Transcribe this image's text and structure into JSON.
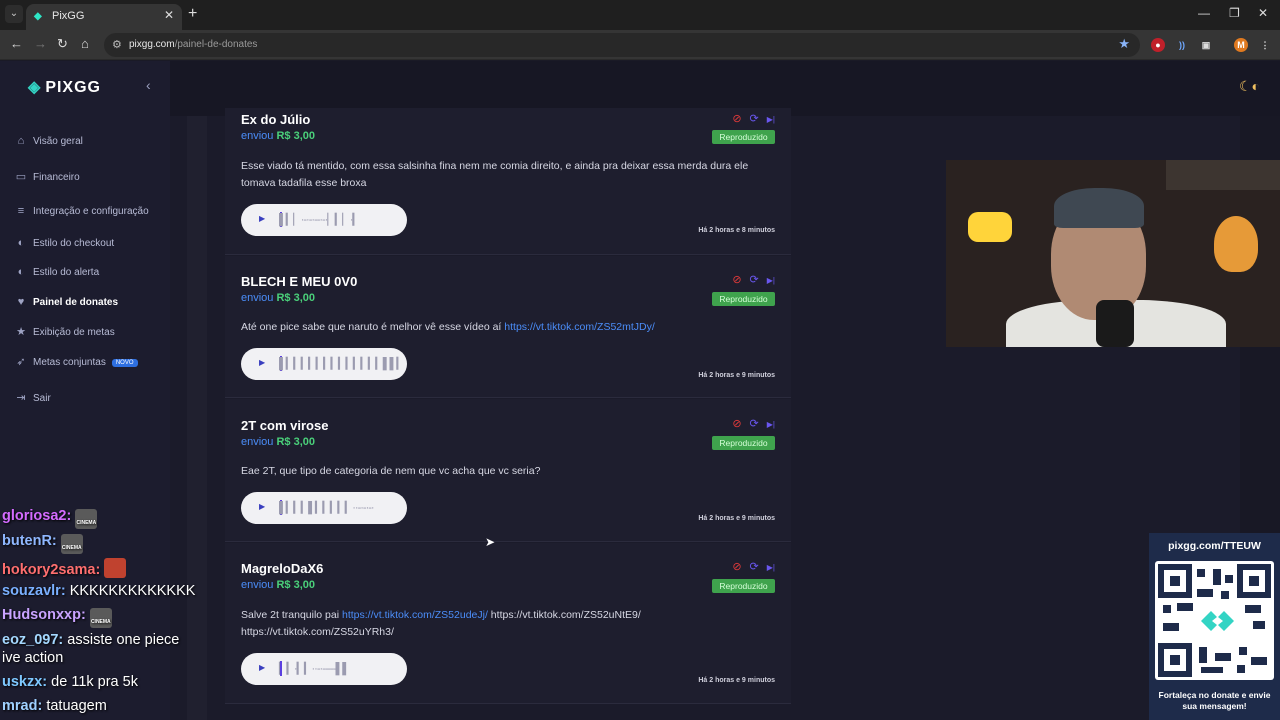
{
  "browser": {
    "tab_title": "PixGG",
    "url_host": "pixgg.com",
    "url_path": "/painel-de-donates",
    "profile_initial": "M"
  },
  "sidebar": {
    "logo": "PIXGG",
    "items": [
      {
        "label": "Visão geral",
        "icon": "home-icon"
      },
      {
        "label": "Financeiro",
        "icon": "wallet-icon"
      },
      {
        "label": "Integração e configuração",
        "icon": "settings-icon"
      },
      {
        "label": "Estilo do checkout",
        "icon": "palette-icon"
      },
      {
        "label": "Estilo do alerta",
        "icon": "palette-icon"
      },
      {
        "label": "Painel de donates",
        "icon": "donates-icon"
      },
      {
        "label": "Exibição de metas",
        "icon": "star-icon"
      },
      {
        "label": "Metas conjuntas",
        "icon": "rocket-icon",
        "badge": "NOVO"
      },
      {
        "label": "Sair",
        "icon": "logout-icon"
      }
    ]
  },
  "donations": [
    {
      "name": "Ex do Júlio",
      "sent": "enviou",
      "amount": "R$ 3,00",
      "message": "Esse viado tá mentido, com essa salsinha fina nem me comia direito, e ainda pra deixar essa merda dura ele tomava tadafila esse broxa",
      "status": "Reproduzido",
      "time": "Há 2 horas e 8 minutos"
    },
    {
      "name": "BLECH E MEU 0V0",
      "sent": "enviou",
      "amount": "R$ 3,00",
      "message_text": "Até one pice sabe que naruto é melhor vê esse vídeo aí ",
      "message_link": "https://vt.tiktok.com/ZS52mtJDy/",
      "status": "Reproduzido",
      "time": "Há 2 horas e 9 minutos"
    },
    {
      "name": "2T com virose",
      "sent": "enviou",
      "amount": "R$ 3,00",
      "message": "Eae 2T, que tipo de categoria de nem que vc acha que vc seria?",
      "status": "Reproduzido",
      "time": "Há 2 horas e 9 minutos"
    },
    {
      "name": "MagreloDaX6",
      "sent": "enviou",
      "amount": "R$ 3,00",
      "message_text": "Salve 2t tranquilo pai ",
      "message_link": "https://vt.tiktok.com/ZS52udeJj/",
      "message_rest": " https://vt.tiktok.com/ZS52uNtE9/ https://vt.tiktok.com/ZS52uYRh3/",
      "status": "Reproduzido",
      "time": "Há 2 horas e 9 minutos"
    }
  ],
  "chat": [
    {
      "user": "gloriosa2:",
      "msg": "",
      "emote": "CINEMA"
    },
    {
      "user": "butenR:",
      "msg": "",
      "emote": "CINEMA"
    },
    {
      "user": "hokory2sama:",
      "msg": "",
      "emote": ""
    },
    {
      "user": "souzavlr:",
      "msg": "KKKKKKKKKKKKK"
    },
    {
      "user": "Hudsonxxp:",
      "msg": "",
      "emote": "CINEMA"
    },
    {
      "user": "eoz_097:",
      "msg": "assiste one piece"
    },
    {
      "user": "",
      "msg": "ive action"
    },
    {
      "user": "uskzx:",
      "msg": "de 11k pra 5k"
    },
    {
      "user": "mrad:",
      "msg": "tatuagem"
    }
  ],
  "qr_panel": {
    "title": "pixgg.com/TTEUW",
    "footer": "Fortaleça no donate e envie sua mensagem!"
  },
  "colors": {
    "accent": "#33d4c4",
    "link": "#4b8df8",
    "amount": "#4ad07a",
    "status": "#3fa34d"
  }
}
